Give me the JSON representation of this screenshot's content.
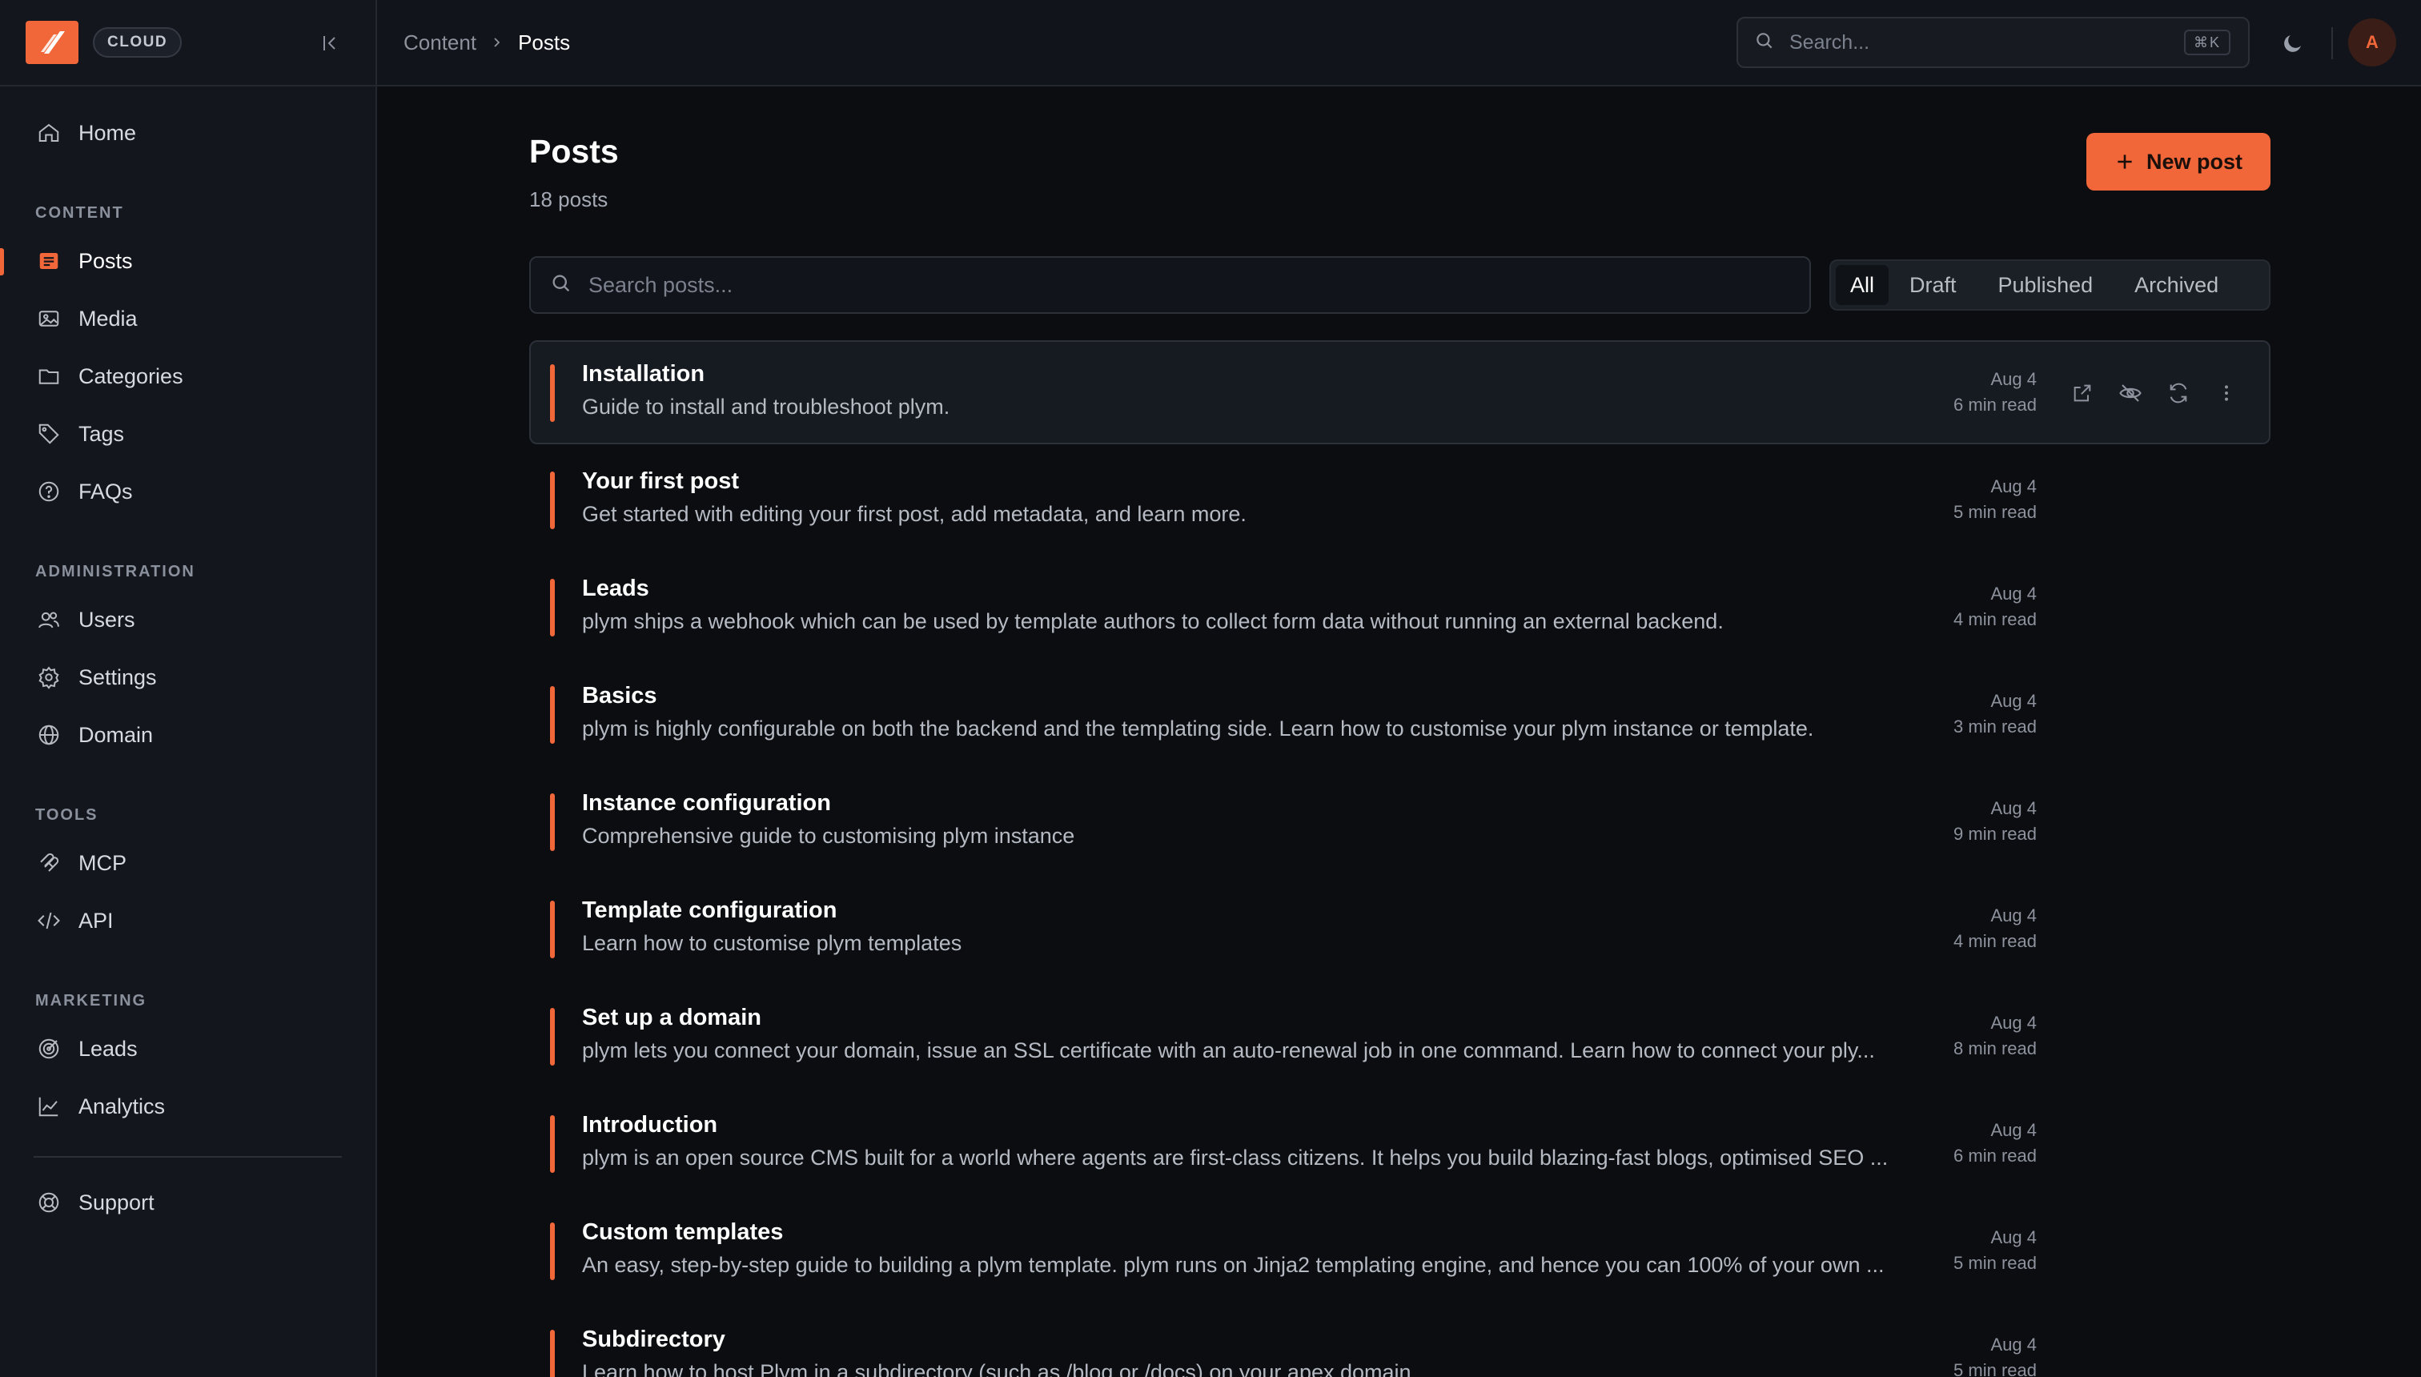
{
  "sidebar": {
    "badge": "CLOUD",
    "nav_top": [
      {
        "label": "Home",
        "icon": "home-icon"
      }
    ],
    "sections": [
      {
        "title": "CONTENT",
        "items": [
          {
            "label": "Posts",
            "icon": "posts-icon",
            "active": true
          },
          {
            "label": "Media",
            "icon": "media-icon"
          },
          {
            "label": "Categories",
            "icon": "folder-icon"
          },
          {
            "label": "Tags",
            "icon": "tag-icon"
          },
          {
            "label": "FAQs",
            "icon": "help-circle-icon"
          }
        ]
      },
      {
        "title": "ADMINISTRATION",
        "items": [
          {
            "label": "Users",
            "icon": "users-icon"
          },
          {
            "label": "Settings",
            "icon": "gear-icon"
          },
          {
            "label": "Domain",
            "icon": "globe-icon"
          }
        ]
      },
      {
        "title": "TOOLS",
        "items": [
          {
            "label": "MCP",
            "icon": "mcp-icon"
          },
          {
            "label": "API",
            "icon": "code-icon"
          }
        ]
      },
      {
        "title": "MARKETING",
        "items": [
          {
            "label": "Leads",
            "icon": "target-icon"
          },
          {
            "label": "Analytics",
            "icon": "chart-icon"
          }
        ]
      }
    ],
    "support": {
      "label": "Support",
      "icon": "lifebuoy-icon"
    }
  },
  "topbar": {
    "breadcrumb": [
      "Content",
      "Posts"
    ],
    "search_placeholder": "Search...",
    "search_shortcut": "⌘K",
    "avatar_initial": "A"
  },
  "main": {
    "title": "Posts",
    "subtitle": "18 posts",
    "new_post_label": "New post",
    "search_placeholder": "Search posts...",
    "filters": [
      "All",
      "Draft",
      "Published",
      "Archived"
    ],
    "active_filter": "All",
    "posts": [
      {
        "title": "Installation",
        "desc": "Guide to install and troubleshoot plym.",
        "date": "Aug 4",
        "read": "6 min read"
      },
      {
        "title": "Your first post",
        "desc": "Get started with editing your first post, add metadata, and learn more.",
        "date": "Aug 4",
        "read": "5 min read"
      },
      {
        "title": "Leads",
        "desc": "plym ships a webhook which can be used by template authors to collect form data without running an external backend.",
        "date": "Aug 4",
        "read": "4 min read"
      },
      {
        "title": "Basics",
        "desc": "plym is highly configurable on both the backend and the templating side. Learn how to customise your plym instance or template.",
        "date": "Aug 4",
        "read": "3 min read"
      },
      {
        "title": "Instance configuration",
        "desc": "Comprehensive guide to customising plym instance",
        "date": "Aug 4",
        "read": "9 min read"
      },
      {
        "title": "Template configuration",
        "desc": "Learn how to customise plym templates",
        "date": "Aug 4",
        "read": "4 min read"
      },
      {
        "title": "Set up a domain",
        "desc": "plym lets you connect your domain, issue an SSL certificate with an auto-renewal job in one command. Learn how to connect your ply...",
        "date": "Aug 4",
        "read": "8 min read"
      },
      {
        "title": "Introduction",
        "desc": "plym is an open source CMS built for a world where agents are first-class citizens. It helps you build blazing-fast blogs, optimised SEO ...",
        "date": "Aug 4",
        "read": "6 min read"
      },
      {
        "title": "Custom templates",
        "desc": "An easy, step-by-step guide to building a plym template. plym runs on Jinja2 templating engine, and hence you can 100% of your own ...",
        "date": "Aug 4",
        "read": "5 min read"
      },
      {
        "title": "Subdirectory",
        "desc": "Learn how to host Plym in a subdirectory (such as /blog or /docs) on your apex domain.",
        "date": "Aug 4",
        "read": "5 min read"
      }
    ],
    "row_actions": [
      "external-link-icon",
      "eye-off-icon",
      "refresh-icon",
      "more-vertical-icon"
    ]
  },
  "colors": {
    "accent": "#f26739",
    "background": "#0b0d11",
    "sidebar": "#13161c"
  }
}
